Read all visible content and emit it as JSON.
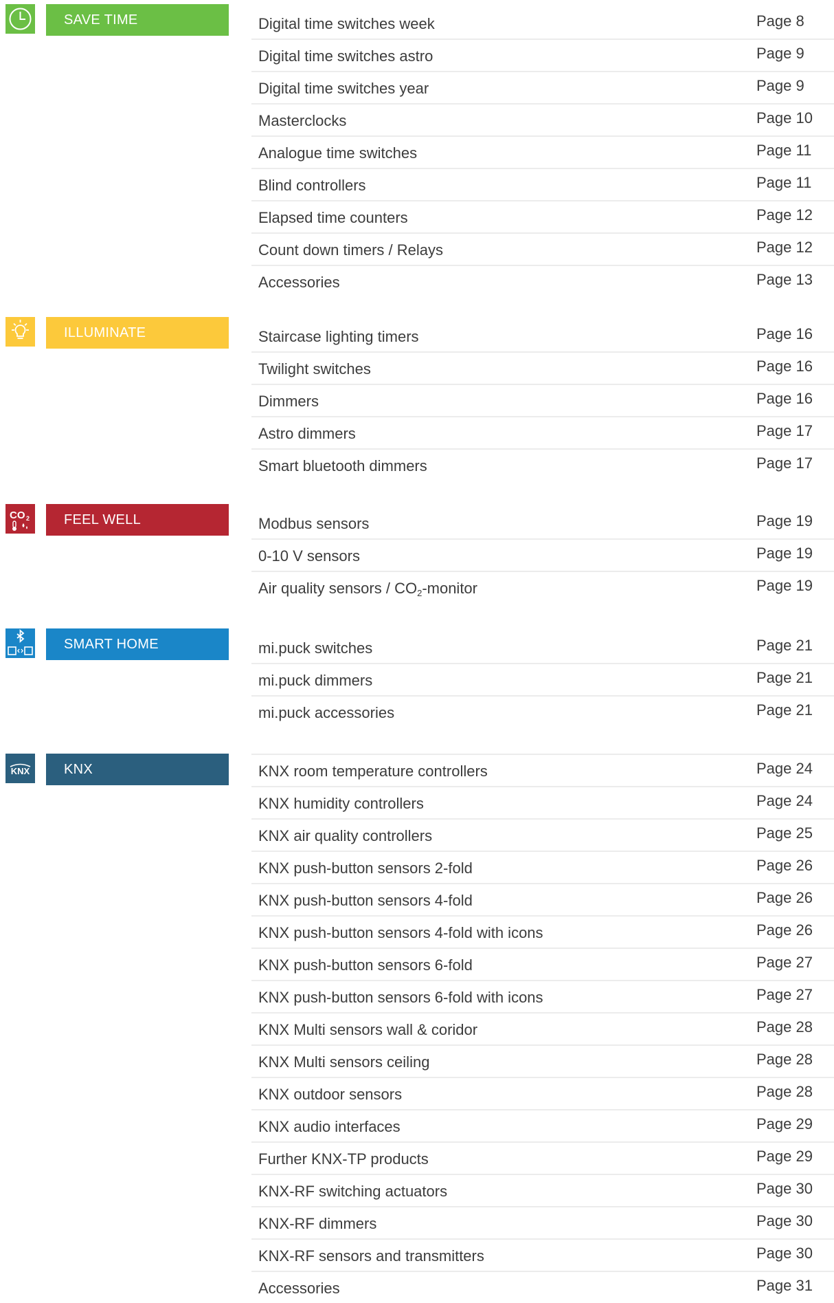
{
  "colors": {
    "save_time": "#6bbf45",
    "illuminate": "#fcc93b",
    "feel_well": "#b52632",
    "smart_home": "#1a86c8",
    "knx": "#2b5f7e",
    "row_divider": "#ececec"
  },
  "sections": [
    {
      "key": "save_time",
      "label": "SAVE TIME",
      "icon": "clock-icon",
      "rows": [
        {
          "name": "Digital time switches week",
          "page": "Page 8"
        },
        {
          "name": "Digital time switches astro",
          "page": "Page 9"
        },
        {
          "name": "Digital time switches year",
          "page": "Page 9"
        },
        {
          "name": "Masterclocks",
          "page": "Page 10"
        },
        {
          "name": "Analogue time switches",
          "page": "Page 11"
        },
        {
          "name": "Blind controllers",
          "page": "Page 11"
        },
        {
          "name": "Elapsed time counters",
          "page": "Page 12"
        },
        {
          "name": "Count down timers / Relays",
          "page": "Page 12"
        },
        {
          "name": "Accessories",
          "page": "Page 13"
        }
      ]
    },
    {
      "key": "illuminate",
      "label": "ILLUMINATE",
      "icon": "lightbulb-icon",
      "rows": [
        {
          "name": "Staircase lighting timers",
          "page": "Page 16"
        },
        {
          "name": "Twilight switches",
          "page": "Page 16"
        },
        {
          "name": "Dimmers",
          "page": "Page 16"
        },
        {
          "name": "Astro dimmers",
          "page": "Page 17"
        },
        {
          "name": "Smart bluetooth dimmers",
          "page": "Page 17"
        }
      ]
    },
    {
      "key": "feel_well",
      "label": "FEEL WELL",
      "icon": "co2-thermometer-icon",
      "icon_text": "CO",
      "icon_sub": "2",
      "rows": [
        {
          "name": "Modbus sensors",
          "page": "Page 19"
        },
        {
          "name": "0-10 V sensors",
          "page": "Page 19"
        },
        {
          "name_pre": "Air quality sensors / CO",
          "name_sub": "2",
          "name_post": "-monitor",
          "page": "Page 19"
        }
      ]
    },
    {
      "key": "smart_home",
      "label": "SMART HOME",
      "icon": "bluetooth-devices-icon",
      "rows": [
        {
          "name": "mi.puck switches",
          "page": "Page 21"
        },
        {
          "name": "mi.puck dimmers",
          "page": "Page 21"
        },
        {
          "name": "mi.puck accessories",
          "page": "Page 21"
        }
      ]
    },
    {
      "key": "knx",
      "label": "KNX",
      "icon": "knx-logo-icon",
      "icon_text": "KNX",
      "rows": [
        {
          "name": "KNX room temperature controllers",
          "page": "Page 24"
        },
        {
          "name": "KNX humidity controllers",
          "page": "Page 24"
        },
        {
          "name": "KNX air quality controllers",
          "page": "Page 25"
        },
        {
          "name": "KNX push-button sensors 2-fold",
          "page": "Page 26"
        },
        {
          "name": "KNX push-button sensors 4-fold",
          "page": "Page 26"
        },
        {
          "name": "KNX push-button sensors 4-fold with icons",
          "page": "Page 26"
        },
        {
          "name": "KNX push-button sensors 6-fold",
          "page": "Page 27"
        },
        {
          "name": "KNX push-button sensors 6-fold with icons",
          "page": "Page 27"
        },
        {
          "name": "KNX Multi sensors wall & coridor",
          "page": "Page 28"
        },
        {
          "name": "KNX Multi sensors ceiling",
          "page": "Page 28"
        },
        {
          "name": "KNX outdoor sensors",
          "page": "Page 28"
        },
        {
          "name": "KNX audio interfaces",
          "page": "Page 29"
        },
        {
          "name": "Further KNX-TP products",
          "page": "Page 29"
        },
        {
          "name": "KNX-RF switching actuators",
          "page": "Page 30"
        },
        {
          "name": "KNX-RF dimmers",
          "page": "Page 30"
        },
        {
          "name": "KNX-RF sensors and transmitters",
          "page": "Page 30"
        },
        {
          "name": "Accessories",
          "page": "Page 31"
        }
      ]
    }
  ]
}
